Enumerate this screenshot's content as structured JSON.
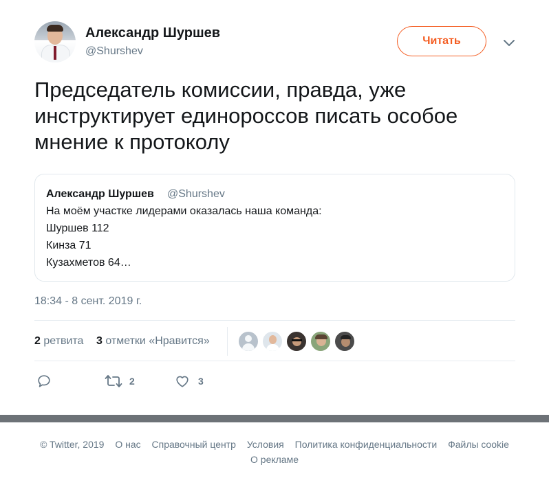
{
  "author": {
    "name": "Александр Шуршев",
    "handle": "@Shurshev"
  },
  "follow_label": "Читать",
  "tweet_text": "Председатель комиссии, правда, уже инструктирует единороссов писать особое мнение к протоколу",
  "quoted": {
    "name": "Александр Шуршев",
    "handle": "@Shurshev",
    "lines": [
      "На моём участке лидерами оказалась наша команда:",
      "Шуршев 112",
      "Кинза 71",
      "Кузахметов 64…"
    ]
  },
  "timestamp": "18:34 - 8 сент. 2019 г.",
  "stats": {
    "retweets_count": "2",
    "retweets_label": "ретвита",
    "likes_count": "3",
    "likes_label": "отметки «Нравится»"
  },
  "actions": {
    "reply_icon": "reply-icon",
    "retweet_icon": "retweet-icon",
    "retweet_count": "2",
    "like_icon": "heart-icon",
    "like_count": "3"
  },
  "footer": {
    "links": [
      "© Twitter, 2019",
      "О нас",
      "Справочный центр",
      "Условия",
      "Политика конфиденциальности",
      "Файлы cookie"
    ],
    "second_line": "О рекламе"
  },
  "colors": {
    "accent": "#f45d22",
    "muted": "#657786",
    "text": "#14171a",
    "band": "#6d7277"
  }
}
